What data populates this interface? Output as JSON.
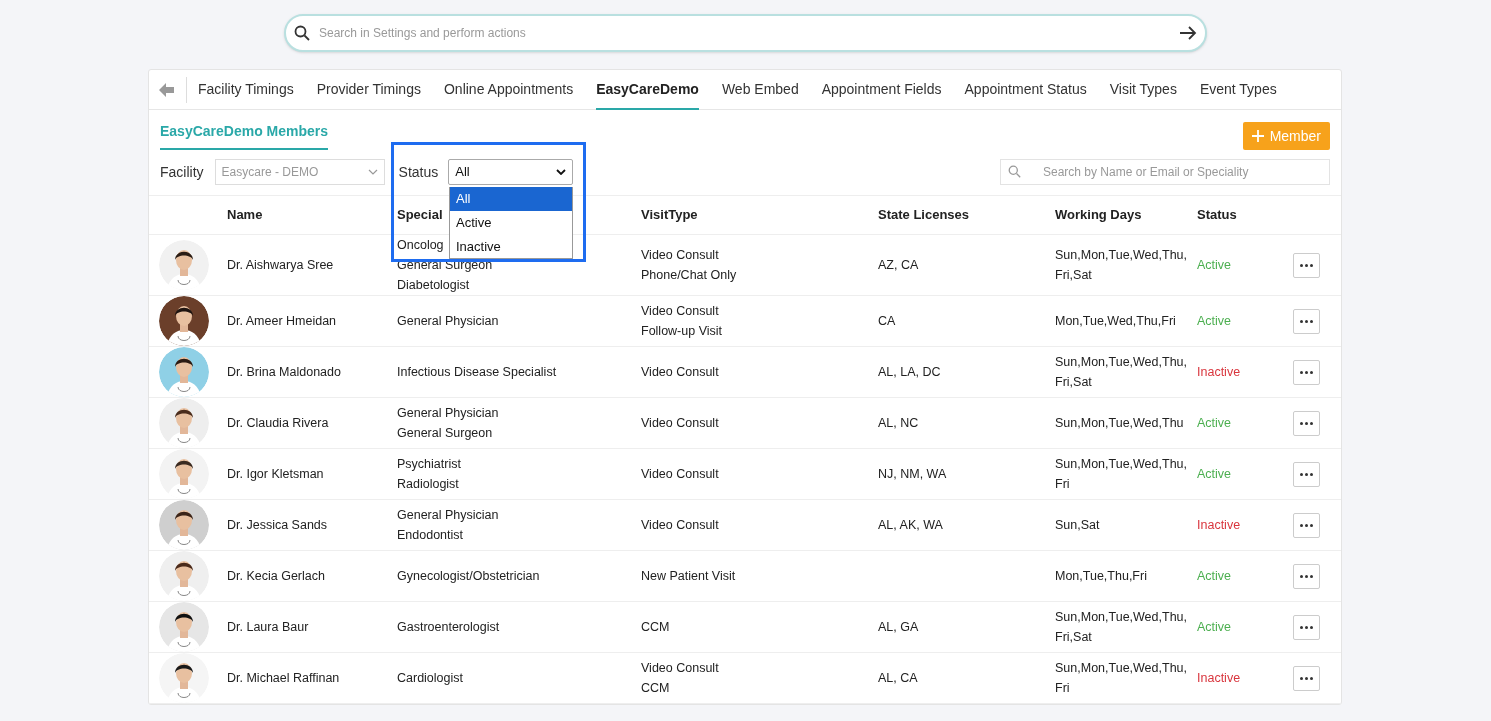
{
  "global_search": {
    "placeholder": "Search in Settings and perform actions"
  },
  "tabs": [
    {
      "label": "Facility Timings",
      "selected": false
    },
    {
      "label": "Provider Timings",
      "selected": false
    },
    {
      "label": "Online Appointments",
      "selected": false
    },
    {
      "label": "EasyCareDemo",
      "selected": true
    },
    {
      "label": "Web Embed",
      "selected": false
    },
    {
      "label": "Appointment Fields",
      "selected": false
    },
    {
      "label": "Appointment Status",
      "selected": false
    },
    {
      "label": "Visit Types",
      "selected": false
    },
    {
      "label": "Event Types",
      "selected": false
    }
  ],
  "section_title": "EasyCareDemo Members",
  "add_button": "Member",
  "filters": {
    "facility_label": "Facility",
    "facility_value": "Easycare - DEMO",
    "status_label": "Status",
    "status_value": "All",
    "status_options": [
      {
        "label": "All",
        "selected": true
      },
      {
        "label": "Active",
        "selected": false
      },
      {
        "label": "Inactive",
        "selected": false
      }
    ]
  },
  "member_search": {
    "placeholder": "Search by Name or Email or Speciality"
  },
  "table": {
    "columns": [
      "Name",
      "Special",
      "VisitType",
      "State Licenses",
      "Working Days",
      "Status"
    ],
    "rows": [
      {
        "name": "Dr. Aishwarya Sree",
        "specialities": [
          "Oncolog",
          "General Surgeon",
          "Diabetologist"
        ],
        "visit_types": [
          "Video Consult",
          "Phone/Chat Only"
        ],
        "state_licenses": "AZ, CA",
        "working_days": "Sun,Mon,Tue,Wed,Thu,Fri,Sat",
        "status": "Active",
        "active": true
      },
      {
        "name": "Dr. Ameer Hmeidan",
        "specialities": [
          "General Physician"
        ],
        "visit_types": [
          "Video Consult",
          "Follow-up Visit"
        ],
        "state_licenses": "CA",
        "working_days": "Mon,Tue,Wed,Thu,Fri",
        "status": "Active",
        "active": true
      },
      {
        "name": "Dr. Brina Maldonado",
        "specialities": [
          "Infectious Disease Specialist"
        ],
        "visit_types": [
          "Video Consult"
        ],
        "state_licenses": "AL, LA, DC",
        "working_days": "Sun,Mon,Tue,Wed,Thu,Fri,Sat",
        "status": "Inactive",
        "active": false
      },
      {
        "name": "Dr. Claudia Rivera",
        "specialities": [
          "General Physician",
          "General Surgeon"
        ],
        "visit_types": [
          "Video Consult"
        ],
        "state_licenses": "AL, NC",
        "working_days": "Sun,Mon,Tue,Wed,Thu",
        "status": "Active",
        "active": true
      },
      {
        "name": "Dr. Igor Kletsman",
        "specialities": [
          "Psychiatrist",
          "Radiologist"
        ],
        "visit_types": [
          "Video Consult"
        ],
        "state_licenses": "NJ, NM, WA",
        "working_days": "Sun,Mon,Tue,Wed,Thu,Fri",
        "status": "Active",
        "active": true
      },
      {
        "name": "Dr. Jessica Sands",
        "specialities": [
          "General Physician",
          "Endodontist"
        ],
        "visit_types": [
          "Video Consult"
        ],
        "state_licenses": "AL, AK, WA",
        "working_days": "Sun,Sat",
        "status": "Inactive",
        "active": false
      },
      {
        "name": "Dr. Kecia Gerlach",
        "specialities": [
          "Gynecologist/Obstetrician"
        ],
        "visit_types": [
          "New Patient Visit"
        ],
        "working_days": "Mon,Tue,Thu,Fri",
        "status": "Active",
        "active": true
      },
      {
        "name": "Dr. Laura Baur",
        "specialities": [
          "Gastroenterologist"
        ],
        "visit_types": [
          "CCM"
        ],
        "state_licenses": "AL, GA",
        "working_days": "Sun,Mon,Tue,Wed,Thu,Fri,Sat",
        "status": "Active",
        "active": true
      },
      {
        "name": "Dr. Michael Raffinan",
        "specialities": [
          "Cardiologist"
        ],
        "visit_types": [
          "Video Consult",
          "CCM"
        ],
        "state_licenses": "AL, CA",
        "working_days": "Sun,Mon,Tue,Wed,Thu,Fri",
        "status": "Inactive",
        "active": false
      }
    ]
  }
}
